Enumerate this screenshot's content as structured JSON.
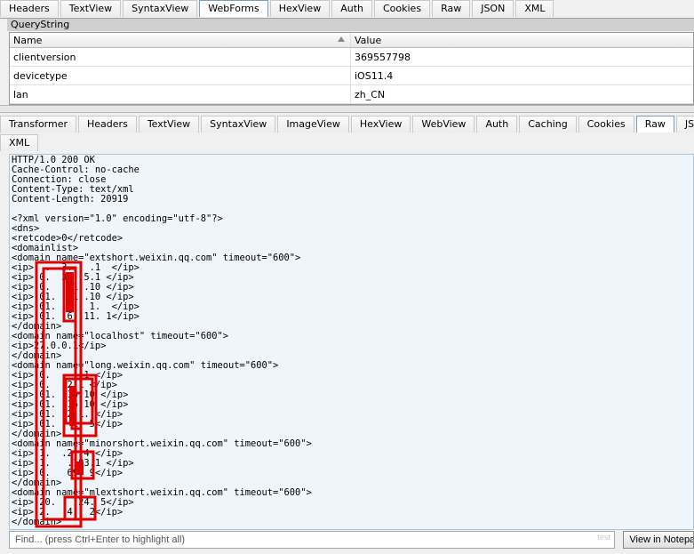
{
  "request_tabs": [
    "Headers",
    "TextView",
    "SyntaxView",
    "WebForms",
    "HexView",
    "Auth",
    "Cookies",
    "Raw",
    "JSON",
    "XML"
  ],
  "request_active_tab": "WebForms",
  "querystring": {
    "title": "QueryString",
    "columns": [
      "Name",
      "Value"
    ],
    "rows": [
      {
        "name": "clientversion",
        "value": "369557798"
      },
      {
        "name": "devicetype",
        "value": "iOS11.4"
      },
      {
        "name": "lan",
        "value": "zh_CN"
      }
    ]
  },
  "response_tabs_row1": [
    "Transformer",
    "Headers",
    "TextView",
    "SyntaxView",
    "ImageView",
    "HexView",
    "WebView",
    "Auth",
    "Caching",
    "Cookies",
    "Raw",
    "JSON"
  ],
  "response_tabs_row2": [
    "XML"
  ],
  "response_active_tab": "Raw",
  "raw_lines": [
    "HTTP/1.0 200 OK",
    "Cache-Control: no-cache",
    "Connection: close",
    "Content-Type: text/xml",
    "Content-Length: 20919",
    "",
    "<?xml version=\"1.0\" encoding=\"utf-8\"?>",
    "<dns>",
    "<retcode>0</retcode>",
    "<domainlist>",
    "<domain name=\"extshort.weixin.qq.com\" timeout=\"600\">",
    "<ip>  .  3.   .1  </ip>",
    "<ip> 0.  3.  5.1 </ip>",
    "<ip> 0.   .1 .10 </ip>",
    "<ip> 01.  .1 .10 </ip>",
    "<ip> 01.  6.  1.  </ip>",
    "<ip> 01.  6. 11. 1</ip>",
    "</domain>",
    "<domain name=\"localhost\" timeout=\"600\">",
    "<ip>27.0.0.1</ip>",
    "</domain>",
    "<domain name=\"long.weixin.qq.com\" timeout=\"600\">",
    "<ip> 0.  .  .1 </ip>",
    "<ip> 0.   2.1 </ip>",
    "<ip> 01.  15 10 </ip>",
    "<ip> 01.  15 10 </ip>",
    "<ip> 01.  2.1. </ip>",
    "<ip> 01.   1. 5</ip>",
    "</domain>",
    "<domain name=\"minorshort.weixin.qq.com\" timeout=\"600\">",
    "<ip> 1.  .2 .4 </ip>",
    "<ip> 1.   .183.1 </ip>",
    "<ip> 0.   69. 9</ip>",
    "</domain>",
    "<domain name=\"mlextshort.weixin.qq.com\" timeout=\"600\">",
    "<ip> 20.   .24. 5</ip>",
    "<ip> 2.   4.  2</ip>",
    "</domain>"
  ],
  "find": {
    "placeholder": "Find... (press Ctrl+Enter to highlight all)"
  },
  "view_in_notepad_label": "View in Notepad",
  "watermark": "test",
  "colors": {
    "redaction": "#e00000",
    "raw_background": "#eef5fb"
  }
}
